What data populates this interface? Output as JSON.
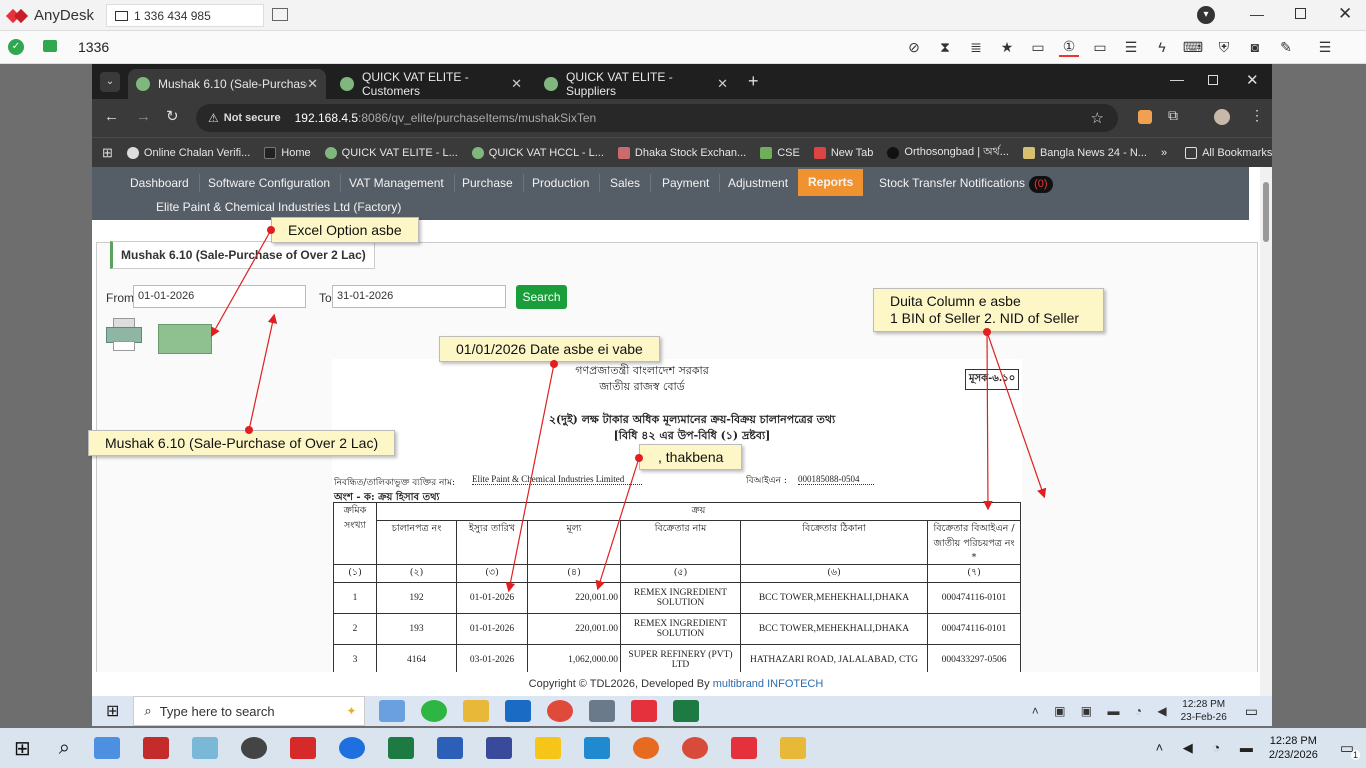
{
  "anydesk": {
    "app": "AnyDesk",
    "address": "1 336 434 985",
    "session_tab": "1336"
  },
  "tabs": [
    {
      "label": "Mushak 6.10 (Sale-Purchase of",
      "active": true
    },
    {
      "label": "QUICK VAT ELITE - Customers",
      "active": false
    },
    {
      "label": "QUICK VAT ELITE - Suppliers",
      "active": false
    }
  ],
  "url": {
    "security": "Not secure",
    "host": "192.168.4.5",
    "path": ":8086/qv_elite/purchaseItems/mushakSixTen"
  },
  "bookmarks": [
    "Online Chalan Verifi...",
    "Home",
    "QUICK VAT ELITE - L...",
    "QUICK VAT HCCL - L...",
    "Dhaka Stock Exchan...",
    "CSE",
    "New Tab",
    "Orthosongbad | অর্থ...",
    "Bangla News 24 - N...",
    "All Bookmarks"
  ],
  "nav": {
    "items": [
      "Dashboard",
      "Software Configuration",
      "VAT Management",
      "Purchase",
      "Production",
      "Sales",
      "Payment",
      "Adjustment",
      "Reports",
      "Stock Transfer Notifications"
    ],
    "badge": "(0)",
    "company": "Elite Paint & Chemical Industries Ltd (Factory)"
  },
  "page_title": "Mushak 6.10 (Sale-Purchase of Over 2 Lac)",
  "filter": {
    "from_label": "From",
    "from_value": "01-01-2026",
    "to_label": "To",
    "to_value": "31-01-2026",
    "search": "Search"
  },
  "report": {
    "gov": "গণপ্রজাতন্ত্রী বাংলাদেশ সরকার",
    "board": "জাতীয় রাজস্ব বোর্ড",
    "form_no": "মূসক-৬.১০",
    "heading": "২(দুই) লক্ষ টাকার অধিক মূল্যমানের ক্রয়-বিক্রয় চালানপত্রের তথ্য",
    "subheading": "[বিধি ৪২ এর উপ-বিধি (১) দ্রষ্টব্য]",
    "name_label": "নিবন্ধিত/তালিকাভুক্ত ব্যক্তির নাম:",
    "name_value": "Elite Paint & Chemical Industries Limited",
    "bin_label": "বিআইএন :",
    "bin_value": "000185088-0504",
    "section": "অংশ - ক: ক্রয় হিসাব তথ্য",
    "group_header": "ক্রয়",
    "headers": [
      "ক্রমিক সংখ্যা",
      "চালানপত্র নং",
      "ইস্যুর তারিখ",
      "মূল্য",
      "বিক্রেতার নাম",
      "বিক্রেতার ঠিকানা",
      "বিক্রেতার বিআইএন / জাতীয় পরিচয়পত্র নং *"
    ],
    "colnums": [
      "(১)",
      "(২)",
      "(৩)",
      "(৪)",
      "(৫)",
      "(৬)",
      "(৭)"
    ],
    "rows": [
      [
        "1",
        "192",
        "01-01-2026",
        "220,001.00",
        "REMEX INGREDIENT SOLUTION",
        "BCC TOWER,MEHEKHALI,DHAKA",
        "000474116-0101"
      ],
      [
        "2",
        "193",
        "01-01-2026",
        "220,001.00",
        "REMEX INGREDIENT SOLUTION",
        "BCC TOWER,MEHEKHALI,DHAKA",
        "000474116-0101"
      ],
      [
        "3",
        "4164",
        "03-01-2026",
        "1,062,000.00",
        "SUPER REFINERY (PVT) LTD",
        "HATHAZARI ROAD, JALALABAD, CTG",
        "000433297-0506"
      ]
    ]
  },
  "footer": {
    "text": "Copyright © TDL2026, Developed By",
    "link": "multibrand INFOTECH"
  },
  "notes": {
    "excel": "Excel Option asbe",
    "title": "Mushak 6.10 (Sale-Purchase of Over 2 Lac)",
    "date": "01/01/2026 Date asbe ei vabe",
    "comma": ", thakbena",
    "column": "Duita Column e  asbe\n1 BIN of Seller 2. NID of Seller"
  },
  "taskbar": {
    "search_placeholder": "Type here to search",
    "time1": "12:28 PM",
    "date1": "23-Feb-26",
    "time2": "12:28 PM",
    "date2": "2/23/2026",
    "notif": "1"
  },
  "colors": {
    "nav_bg": "#555d66",
    "active_nav": "#f0922f",
    "search_btn": "#1a9e3a",
    "note_bg": "#fdf7c8",
    "arrow": "#e02020"
  }
}
